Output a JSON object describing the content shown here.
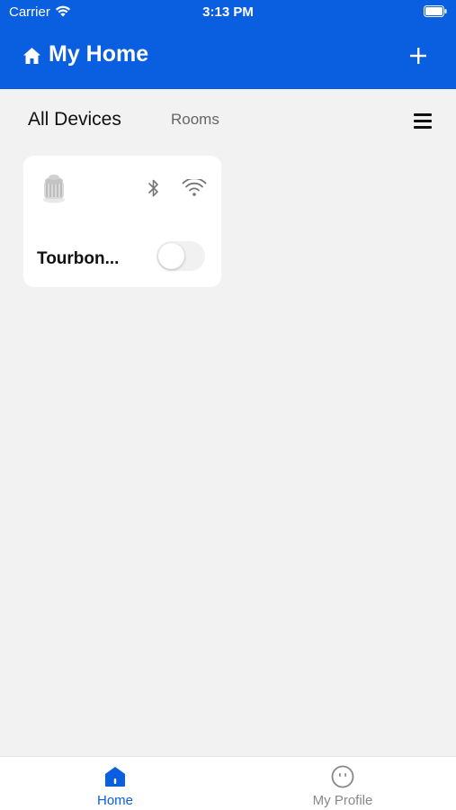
{
  "status_bar": {
    "carrier": "Carrier",
    "time": "3:13 PM"
  },
  "header": {
    "title": "My Home",
    "add_label": "+",
    "icon": "home-icon"
  },
  "tabs": {
    "all_devices": "All Devices",
    "rooms": "Rooms",
    "active": "All Devices"
  },
  "devices": [
    {
      "name": "Tourbon...",
      "connectivity": [
        "bluetooth-icon",
        "wifi-icon"
      ],
      "power_on": false
    }
  ],
  "tabbar": {
    "home": "Home",
    "profile": "My Profile",
    "active": "Home"
  },
  "colors": {
    "brand": "#0a5ee0",
    "background": "#f2f2f2",
    "card": "#ffffff",
    "inactive": "#888888"
  }
}
